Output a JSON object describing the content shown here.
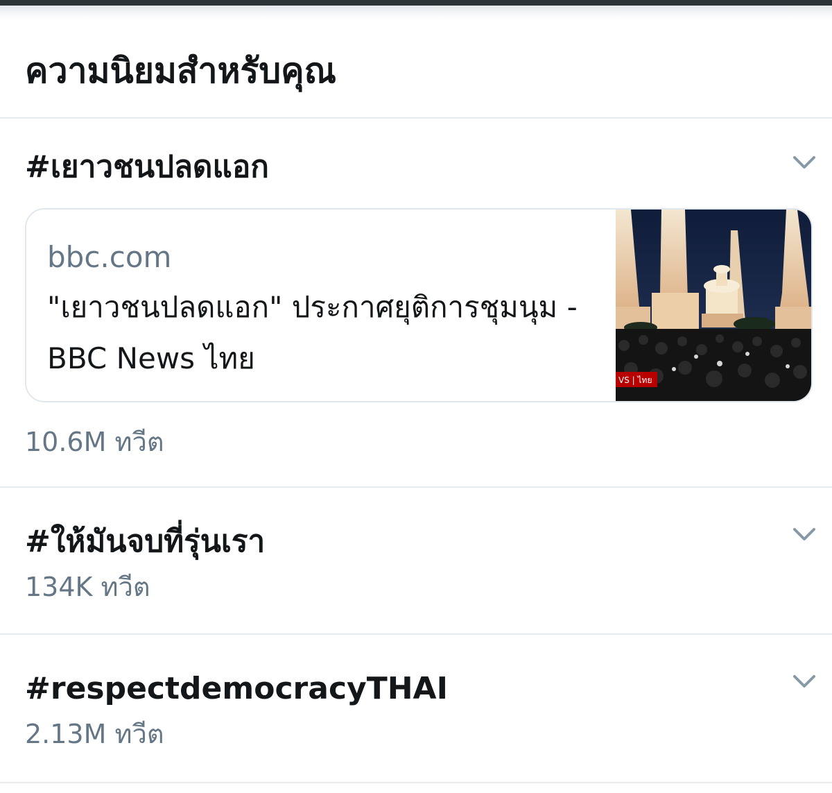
{
  "header": {
    "title": "ความนิยมสำหรับคุณ"
  },
  "trends": [
    {
      "hashtag": "#เยาวชนปลดแอก",
      "card": {
        "domain": "bbc.com",
        "headline": "\"เยาวชนปลดแอก\" ประกาศยุติการชุมนุม - BBC News ไทย",
        "thumbnail_badge": "VS | ไทย"
      },
      "count": "10.6M ทวีต"
    },
    {
      "hashtag": "#ให้มันจบที่รุ่นเรา",
      "count": "134K ทวีต"
    },
    {
      "hashtag": "#respectdemocracyTHAI",
      "count": "2.13M ทวีต"
    }
  ],
  "colors": {
    "text_primary": "#14171a",
    "text_secondary": "#657786",
    "divider": "#e6ecf0",
    "chevron": "#8899a6"
  },
  "icons": {
    "chevron": "chevron-down-icon"
  }
}
